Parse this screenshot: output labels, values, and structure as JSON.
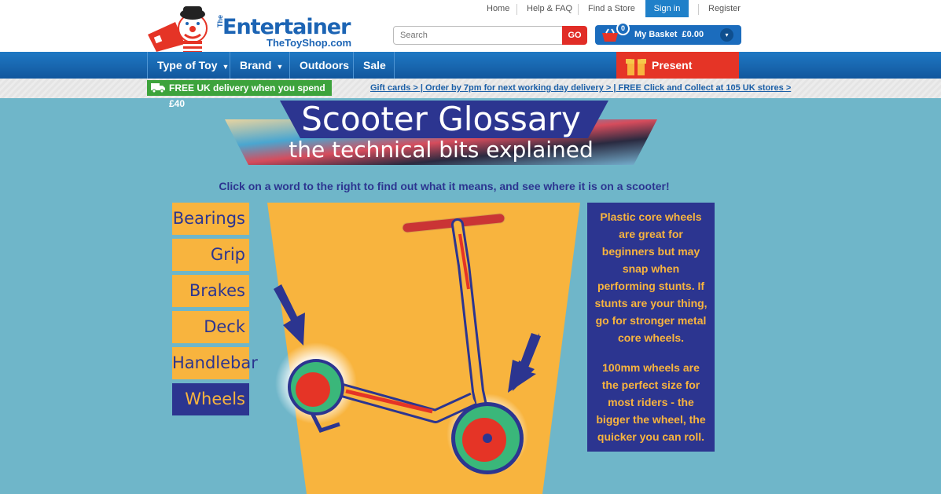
{
  "logo": {
    "the": "The",
    "title": "Entertainer",
    "sub": "TheToyShop.com"
  },
  "toplinks": {
    "home": "Home",
    "help": "Help & FAQ",
    "store": "Find a Store",
    "signin": "Sign in",
    "register": "Register"
  },
  "search": {
    "placeholder": "Search",
    "go": "GO"
  },
  "basket": {
    "count": "0",
    "label": "My Basket",
    "amount": "£0.00"
  },
  "nav": {
    "items": [
      {
        "label": "Type of Toy"
      },
      {
        "label": "Brand"
      },
      {
        "label": "Outdoors"
      },
      {
        "label": "Sale"
      }
    ],
    "present_finder": "Present Finder"
  },
  "strip": {
    "free_delivery": "FREE UK delivery when you spend £40",
    "links": "Gift cards > | Order by 7pm for next working day delivery > | FREE Click and Collect at 105 UK stores >"
  },
  "banner": {
    "title": "Scooter Glossary",
    "subtitle": "the technical bits explained"
  },
  "instruction": "Click on a word to the right to find out what it means, and see where it is on a scooter!",
  "glossary": {
    "items": [
      "Bearings",
      "Grip",
      "Brakes",
      "Deck",
      "Handlebar",
      "Wheels"
    ],
    "active": "Wheels"
  },
  "info": {
    "p1": "Plastic core wheels are great for beginners but may snap when performing stunts. If stunts are your thing, go for stronger metal core wheels.",
    "p2": "100mm wheels are the perfect size for most riders - the bigger the wheel, the quicker you can roll."
  },
  "colors": {
    "blue": "#1f79c4",
    "red": "#e53426",
    "orange": "#f8b43e",
    "navy": "#2c3590",
    "teal": "#6fb6c9",
    "green": "#3da33c"
  }
}
